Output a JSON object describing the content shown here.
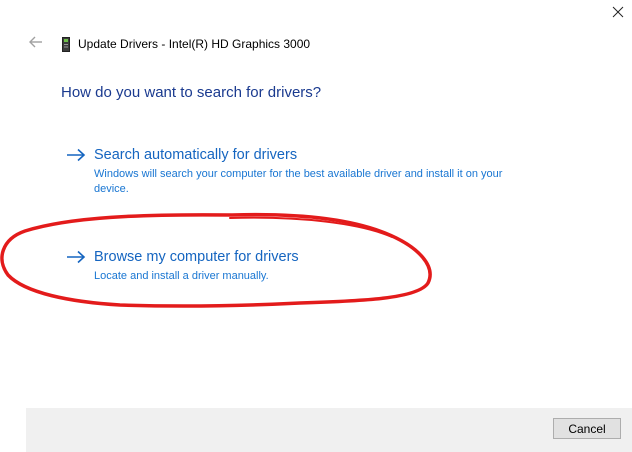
{
  "window": {
    "title": "Update Drivers - Intel(R) HD Graphics 3000",
    "close_icon": "close-icon",
    "back_icon": "back-arrow-icon",
    "device_icon": "display-adapter-icon"
  },
  "main": {
    "question": "How do you want to search for drivers?",
    "options": [
      {
        "title": "Search automatically for drivers",
        "description": "Windows will search your computer for the best available driver and install it on your device.",
        "icon": "arrow-right-icon"
      },
      {
        "title": "Browse my computer for drivers",
        "description": "Locate and install a driver manually.",
        "icon": "arrow-right-icon"
      }
    ],
    "annotation": {
      "shape": "hand-drawn ellipse",
      "color": "#e31b1b",
      "target": "Browse my computer for drivers"
    }
  },
  "footer": {
    "cancel_label": "Cancel"
  },
  "colors": {
    "question_text": "#1a3a8f",
    "link_title": "#1565c0",
    "link_description": "#1976d2",
    "footer_bg": "#f0f0f0"
  }
}
